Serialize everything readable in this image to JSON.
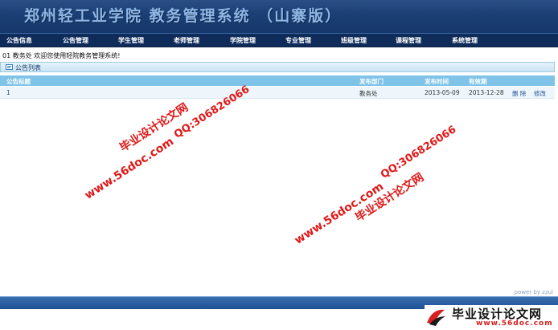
{
  "app": {
    "title": "郑州轻工业学院 教务管理系统 （山寨版）"
  },
  "nav": {
    "items": [
      {
        "label": "公告信息",
        "name": "nav-announcements"
      },
      {
        "label": "公告管理",
        "name": "nav-announcement-management"
      },
      {
        "label": "学生管理",
        "name": "nav-student-management"
      },
      {
        "label": "老师管理",
        "name": "nav-teacher-management"
      },
      {
        "label": "学院管理",
        "name": "nav-college-management"
      },
      {
        "label": "专业管理",
        "name": "nav-major-management"
      },
      {
        "label": "班级管理",
        "name": "nav-class-management"
      },
      {
        "label": "课程管理",
        "name": "nav-course-management"
      },
      {
        "label": "系统管理",
        "name": "nav-system-management"
      }
    ]
  },
  "welcome": "01 教务处 欢迎您使用轻院教务管理系统!",
  "panel": {
    "title": "公告列表",
    "icon": "list-icon"
  },
  "table": {
    "columns": [
      "公告标题",
      "发布部门",
      "发布时间",
      "有效期"
    ],
    "rows": [
      {
        "title": "1",
        "department": "教务处",
        "publish_date": "2013-05-09",
        "expiry_date": "2013-12-28",
        "actions": [
          "删 除",
          "修改"
        ]
      }
    ]
  },
  "watermarks": {
    "site_name": "毕业设计论文网",
    "qq": "QQ:306826066",
    "url": "www.56doc.com"
  },
  "footer": {
    "power": "power by zzul"
  },
  "logo": {
    "text": "毕业设计论文网",
    "url": "www.56doc.com"
  },
  "colors": {
    "banner": "#1b3f74",
    "nav": "#0e2b5a",
    "table_header": "#7fc4e8",
    "watermark": "#e01818"
  }
}
